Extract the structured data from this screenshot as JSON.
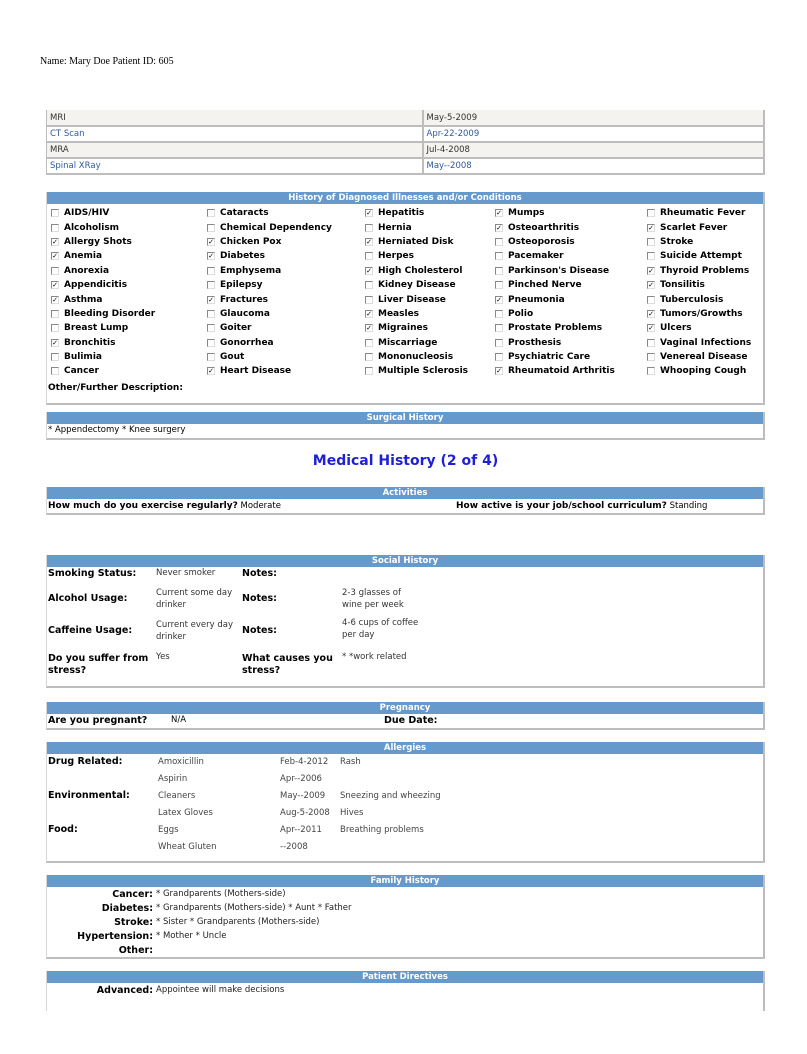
{
  "patient": {
    "line": "Name: Mary Doe  Patient ID: 605"
  },
  "imaging": [
    {
      "test": "MRI",
      "date": "May-5-2009"
    },
    {
      "test": "CT Scan",
      "date": "Apr-22-2009"
    },
    {
      "test": "MRA",
      "date": "Jul-4-2008"
    },
    {
      "test": "Spinal XRay",
      "date": "May--2008"
    }
  ],
  "illnesses": {
    "title": "History of Diagnosed Illnesses and/or Conditions",
    "columns": [
      [
        {
          "label": "AIDS/HIV",
          "checked": false
        },
        {
          "label": "Alcoholism",
          "checked": false
        },
        {
          "label": "Allergy Shots",
          "checked": true
        },
        {
          "label": "Anemia",
          "checked": true
        },
        {
          "label": "Anorexia",
          "checked": false
        },
        {
          "label": "Appendicitis",
          "checked": true
        },
        {
          "label": "Asthma",
          "checked": true
        },
        {
          "label": "Bleeding Disorder",
          "checked": false
        },
        {
          "label": "Breast Lump",
          "checked": false
        },
        {
          "label": "Bronchitis",
          "checked": true
        },
        {
          "label": "Bulimia",
          "checked": false
        },
        {
          "label": "Cancer",
          "checked": false
        }
      ],
      [
        {
          "label": "Cataracts",
          "checked": false
        },
        {
          "label": "Chemical Dependency",
          "checked": false
        },
        {
          "label": "Chicken Pox",
          "checked": true
        },
        {
          "label": "Diabetes",
          "checked": true
        },
        {
          "label": "Emphysema",
          "checked": false
        },
        {
          "label": "Epilepsy",
          "checked": false
        },
        {
          "label": "Fractures",
          "checked": true
        },
        {
          "label": "Glaucoma",
          "checked": false
        },
        {
          "label": "Goiter",
          "checked": false
        },
        {
          "label": "Gonorrhea",
          "checked": false
        },
        {
          "label": "Gout",
          "checked": false
        },
        {
          "label": "Heart Disease",
          "checked": true
        }
      ],
      [
        {
          "label": "Hepatitis",
          "checked": true
        },
        {
          "label": "Hernia",
          "checked": false
        },
        {
          "label": "Herniated Disk",
          "checked": true
        },
        {
          "label": "Herpes",
          "checked": false
        },
        {
          "label": "High Cholesterol",
          "checked": true
        },
        {
          "label": "Kidney Disease",
          "checked": false
        },
        {
          "label": "Liver Disease",
          "checked": false
        },
        {
          "label": "Measles",
          "checked": true
        },
        {
          "label": "Migraines",
          "checked": true
        },
        {
          "label": "Miscarriage",
          "checked": false
        },
        {
          "label": "Mononucleosis",
          "checked": false
        },
        {
          "label": "Multiple Sclerosis",
          "checked": false
        }
      ],
      [
        {
          "label": "Mumps",
          "checked": true
        },
        {
          "label": "Osteoarthritis",
          "checked": true
        },
        {
          "label": "Osteoporosis",
          "checked": false
        },
        {
          "label": "Pacemaker",
          "checked": false
        },
        {
          "label": "Parkinson's Disease",
          "checked": false
        },
        {
          "label": "Pinched Nerve",
          "checked": false
        },
        {
          "label": "Pneumonia",
          "checked": true
        },
        {
          "label": "Polio",
          "checked": false
        },
        {
          "label": "Prostate Problems",
          "checked": false
        },
        {
          "label": "Prosthesis",
          "checked": false
        },
        {
          "label": "Psychiatric Care",
          "checked": false
        },
        {
          "label": "Rheumatoid Arthritis",
          "checked": true
        }
      ],
      [
        {
          "label": "Rheumatic Fever",
          "checked": false
        },
        {
          "label": "Scarlet Fever",
          "checked": true
        },
        {
          "label": "Stroke",
          "checked": false
        },
        {
          "label": "Suicide Attempt",
          "checked": false
        },
        {
          "label": "Thyroid Problems",
          "checked": true
        },
        {
          "label": "Tonsilitis",
          "checked": true
        },
        {
          "label": "Tuberculosis",
          "checked": false
        },
        {
          "label": "Tumors/Growths",
          "checked": true
        },
        {
          "label": "Ulcers",
          "checked": true
        },
        {
          "label": "Vaginal Infections",
          "checked": false
        },
        {
          "label": "Venereal Disease",
          "checked": false
        },
        {
          "label": "Whooping Cough",
          "checked": false
        }
      ]
    ],
    "other_label": "Other/Further Description:"
  },
  "surgical": {
    "title": "Surgical History",
    "text": "* Appendectomy * Knee surgery"
  },
  "page_title": "Medical History (2 of 4)",
  "activities": {
    "title": "Activities",
    "q1": "How much do you exercise regularly?",
    "a1": "Moderate",
    "q2": "How active is your job/school curriculum?",
    "a2": "Standing"
  },
  "social": {
    "title": "Social History",
    "rows": [
      {
        "label": "Smoking Status:",
        "value": "Never smoker",
        "notes_label": "Notes:",
        "notes": ""
      },
      {
        "label": "Alcohol Usage:",
        "value": "Current some day drinker",
        "notes_label": "Notes:",
        "notes": "2-3 glasses of wine per week"
      },
      {
        "label": "Caffeine Usage:",
        "value": "Current every day drinker",
        "notes_label": "Notes:",
        "notes": "4-6 cups of coffee per day"
      },
      {
        "label": "Do you suffer from stress?",
        "value": "Yes",
        "notes_label": "What causes you stress?",
        "notes": "* *work related"
      }
    ]
  },
  "pregnancy": {
    "title": "Pregnancy",
    "q": "Are you pregnant?",
    "a": "N/A",
    "due_label": "Due Date:",
    "due": ""
  },
  "allergies": {
    "title": "Allergies",
    "rows": [
      {
        "category": "Drug Related:",
        "item": "Amoxicillin",
        "date": "Feb-4-2012",
        "reaction": "Rash"
      },
      {
        "category": "",
        "item": "Aspirin",
        "date": "Apr--2006",
        "reaction": ""
      },
      {
        "category": "Environmental:",
        "item": "Cleaners",
        "date": "May--2009",
        "reaction": "Sneezing and wheezing"
      },
      {
        "category": "",
        "item": "Latex Gloves",
        "date": "Aug-5-2008",
        "reaction": "Hives"
      },
      {
        "category": "Food:",
        "item": "Eggs",
        "date": "Apr--2011",
        "reaction": "Breathing problems"
      },
      {
        "category": "",
        "item": "Wheat Gluten",
        "date": "--2008",
        "reaction": ""
      }
    ]
  },
  "family": {
    "title": "Family History",
    "rows": [
      {
        "label": "Cancer:",
        "value": "* Grandparents (Mothers-side)"
      },
      {
        "label": "Diabetes:",
        "value": "* Grandparents (Mothers-side) * Aunt * Father"
      },
      {
        "label": "Stroke:",
        "value": "* Sister * Grandparents (Mothers-side)"
      },
      {
        "label": "Hypertension:",
        "value": "* Mother * Uncle"
      },
      {
        "label": "Other:",
        "value": ""
      }
    ]
  },
  "directives": {
    "title": "Patient Directives",
    "label": "Advanced:",
    "value": "Appointee will make decisions"
  },
  "colors": {
    "header_bg": "#6699cc",
    "title_blue": "#1f1fd6",
    "link_blue": "#2f5a9c"
  }
}
